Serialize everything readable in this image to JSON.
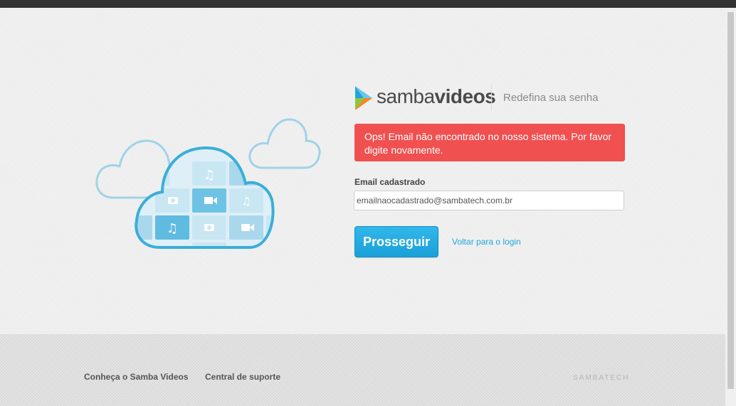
{
  "brand": {
    "logo_light": "samba",
    "logo_bold": "videos",
    "colors": {
      "logo_orange": "#f08a24",
      "logo_green": "#8cc63f",
      "logo_blue": "#1ea7dc"
    }
  },
  "header": {
    "subtitle": "Redefina sua senha"
  },
  "alert": {
    "message": "Ops! Email não encontrado no nosso sistema. Por favor digite novamente.",
    "color": "#f05050"
  },
  "form": {
    "email_label": "Email cadastrado",
    "email_value": "emailnaocadastrado@sambatech.com.br",
    "submit_label": "Prosseguir",
    "back_link": "Voltar para o login",
    "accent_color": "#1ea7dc"
  },
  "illustration": {
    "icons": [
      "music-note-icon",
      "video-camera-icon",
      "camera-icon",
      "music-note-icon",
      "camera-icon",
      "video-camera-icon"
    ]
  },
  "footer": {
    "links": [
      "Conheça o Samba Videos",
      "Central de suporte"
    ],
    "brand": "SAMBATECH"
  }
}
